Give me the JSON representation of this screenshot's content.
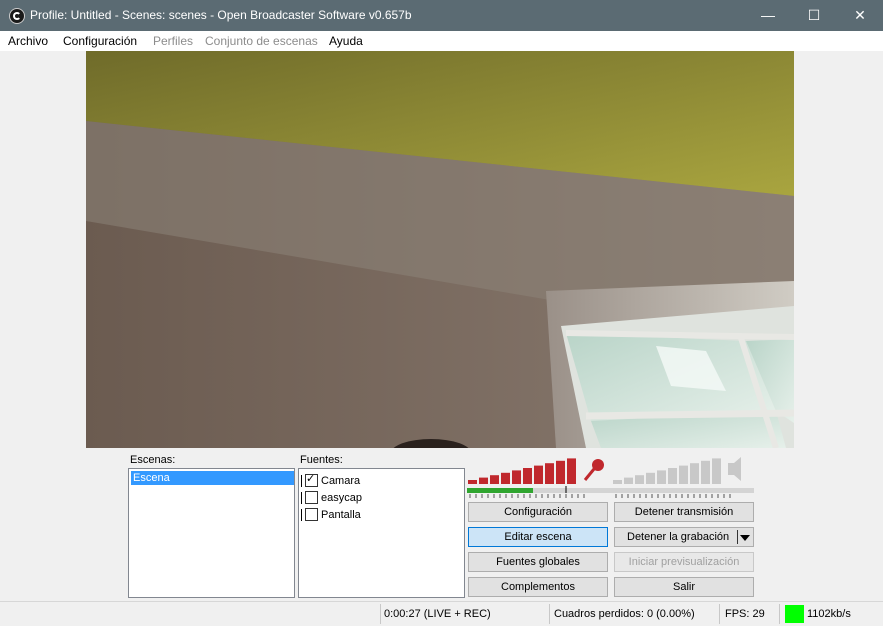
{
  "window": {
    "title": "Profile: Untitled - Scenes: scenes - Open Broadcaster Software v0.657b",
    "minimize": "—",
    "maximize": "☐",
    "close": "✕"
  },
  "menu": {
    "items": [
      "Archivo",
      "Configuración",
      "Perfiles",
      "Conjunto de escenas",
      "Ayuda"
    ]
  },
  "scenes": {
    "label": "Escenas:",
    "items": [
      "Escena"
    ]
  },
  "sources": {
    "label": "Fuentes:",
    "items": [
      {
        "name": "Camara",
        "checked": true
      },
      {
        "name": "easycap",
        "checked": false
      },
      {
        "name": "Pantalla",
        "checked": false
      }
    ]
  },
  "audio": {
    "mic_level": 0.55,
    "desktop_level": 0.0,
    "mic_color": "#c0282d",
    "desktop_color": "#c8c8c8",
    "meter_color": "#2fa52f"
  },
  "buttons": {
    "settings": "Configuración",
    "stop_stream": "Detener transmisión",
    "edit_scene": "Editar escena",
    "stop_recording": "Detener la grabación",
    "global_sources": "Fuentes globales",
    "start_preview": "Iniciar previsualización",
    "plugins": "Complementos",
    "exit": "Salir"
  },
  "status": {
    "time": "0:00:27 (LIVE + REC)",
    "dropped": "Cuadros perdidos: 0 (0.00%)",
    "fps": "FPS: 29",
    "bitrate": "1102kb/s",
    "indicator_color": "#00ff00"
  }
}
